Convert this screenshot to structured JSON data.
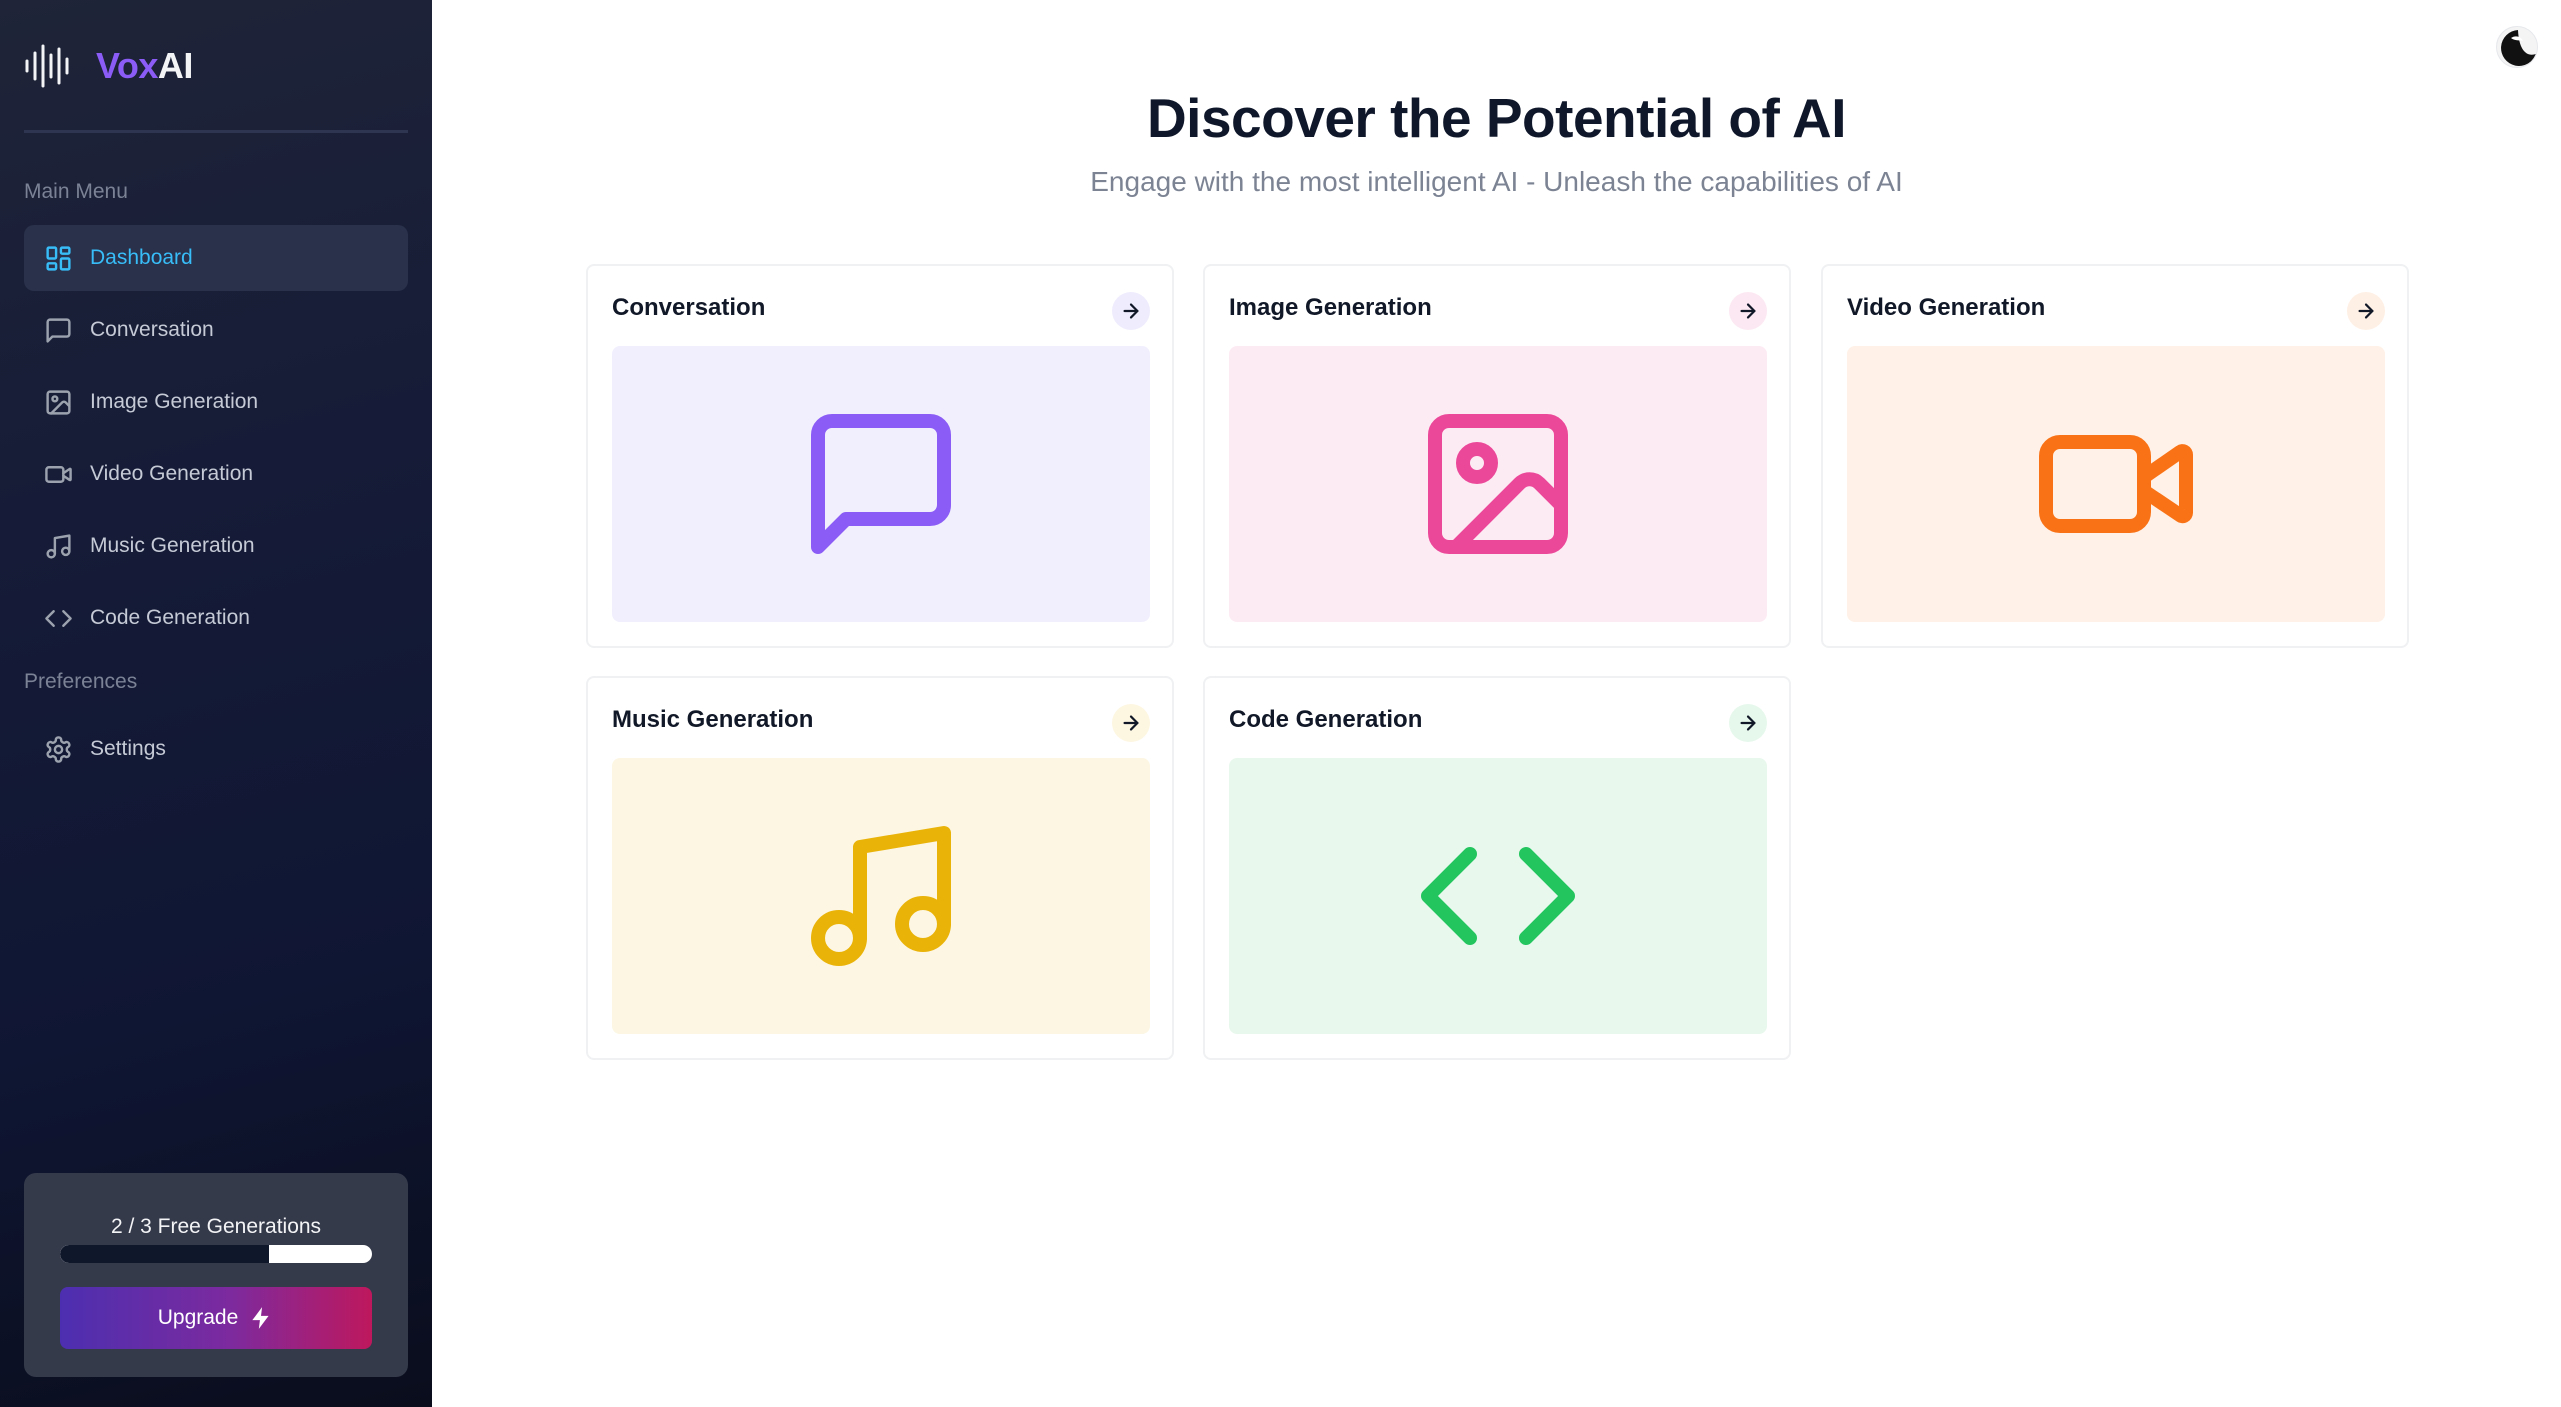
{
  "brand": {
    "name_part1": "Vox",
    "name_part2": "AI",
    "logo_icon": "audio-waveform-icon"
  },
  "sidebar": {
    "main_menu_label": "Main Menu",
    "preferences_label": "Preferences",
    "items": [
      {
        "label": "Dashboard",
        "icon": "dashboard-grid-icon",
        "active": true
      },
      {
        "label": "Conversation",
        "icon": "message-square-icon"
      },
      {
        "label": "Image Generation",
        "icon": "image-icon"
      },
      {
        "label": "Video Generation",
        "icon": "video-camera-icon"
      },
      {
        "label": "Music Generation",
        "icon": "music-note-icon"
      },
      {
        "label": "Code Generation",
        "icon": "code-brackets-icon"
      }
    ],
    "preference_items": [
      {
        "label": "Settings",
        "icon": "gear-icon"
      }
    ]
  },
  "usage": {
    "text": "2 / 3 Free Generations",
    "progress": 0.67,
    "upgrade_label": "Upgrade",
    "upgrade_icon": "lightning-bolt-icon"
  },
  "main": {
    "title": "Discover the Potential of AI",
    "subtitle": "Engage with the most intelligent AI - Unleash the capabilities of AI"
  },
  "tools": [
    {
      "label": "Conversation",
      "icon": "message-square-icon",
      "color": "#8b5cf6",
      "bg": "#f1effd",
      "arrow_bg": "#efecfd"
    },
    {
      "label": "Image Generation",
      "icon": "image-icon",
      "color": "#ec4899",
      "bg": "#fdebf4",
      "arrow_bg": "#fce8f2"
    },
    {
      "label": "Video Generation",
      "icon": "video-camera-icon",
      "color": "#f97316",
      "bg": "#fff1e7",
      "arrow_bg": "#fff0e5"
    },
    {
      "label": "Music Generation",
      "icon": "music-note-icon",
      "color": "#eab308",
      "bg": "#fcf6e3",
      "arrow_bg": "#fdf6e1"
    },
    {
      "label": "Code Generation",
      "icon": "code-brackets-icon",
      "color": "#22c55e",
      "bg": "#e8f8ed",
      "arrow_bg": "#e6f8ec"
    }
  ],
  "user": {
    "avatar_icon": "user-avatar"
  }
}
